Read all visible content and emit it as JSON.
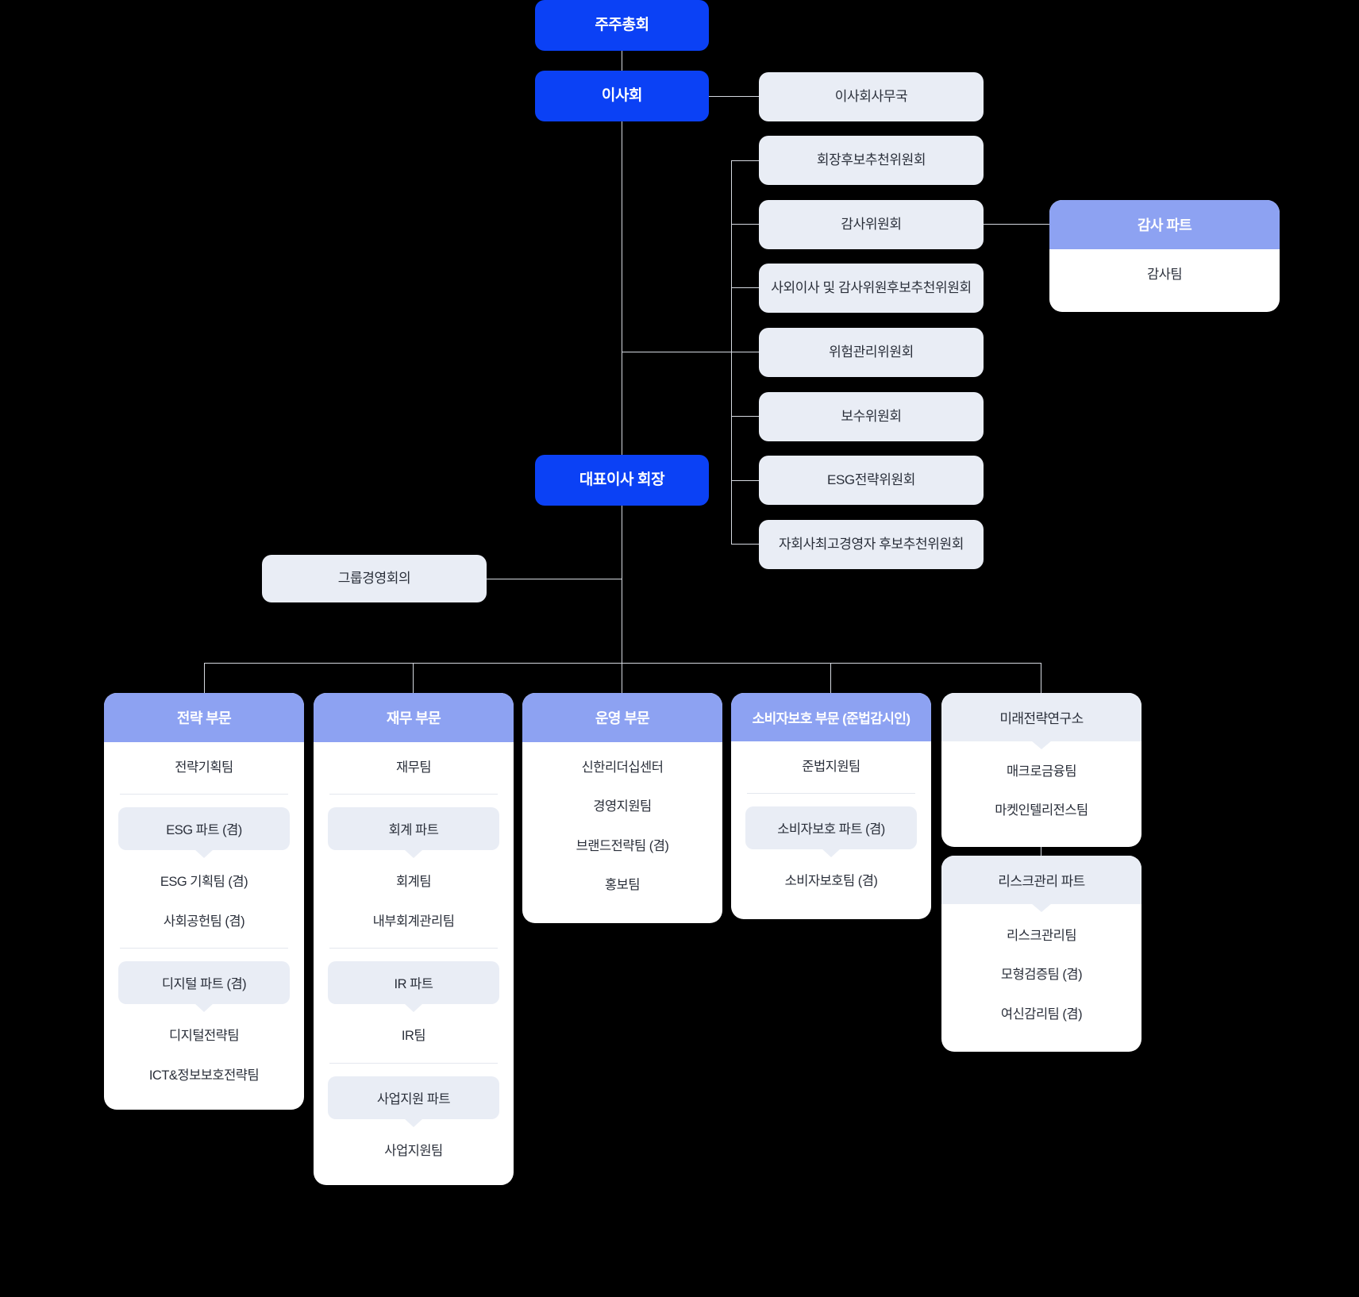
{
  "colors": {
    "primary": "#0b41f5",
    "division_header": "#8da2f2",
    "neutral_box": "#e9edf5",
    "line": "#d5d9e0",
    "background": "#000000",
    "card": "#ffffff",
    "text_dark": "#2a2f3a"
  },
  "top": {
    "shareholders_meeting": "주주총회",
    "board_of_directors": "이사회",
    "board_secretariat": "이사회사무국",
    "ceo_chairman": "대표이사 회장",
    "group_management_meeting": "그룹경영회의"
  },
  "committees": [
    {
      "label": "회장후보추천위원회"
    },
    {
      "label": "감사위원회"
    },
    {
      "label": "사외이사 및 감사위원후보추천위원회"
    },
    {
      "label": "위험관리위원회"
    },
    {
      "label": "보수위원회"
    },
    {
      "label": "ESG전략위원회"
    },
    {
      "label": "자회사최고경영자 후보추천위원회"
    }
  ],
  "audit": {
    "header": "감사 파트",
    "teams": [
      "감사팀"
    ]
  },
  "divisions": [
    {
      "header": "전략 부문",
      "header_style": "accent",
      "groups": [
        {
          "part": null,
          "teams": [
            "전략기획팀"
          ]
        },
        {
          "part": "ESG 파트 (겸)",
          "teams": [
            "ESG 기획팀 (겸)",
            "사회공헌팀 (겸)"
          ]
        },
        {
          "part": "디지털 파트 (겸)",
          "teams": [
            "디지털전략팀",
            "ICT&정보보호전략팀"
          ]
        }
      ]
    },
    {
      "header": "재무 부문",
      "header_style": "accent",
      "groups": [
        {
          "part": null,
          "teams": [
            "재무팀"
          ]
        },
        {
          "part": "회계 파트",
          "teams": [
            "회계팀",
            "내부회계관리팀"
          ]
        },
        {
          "part": "IR 파트",
          "teams": [
            "IR팀"
          ]
        },
        {
          "part": "사업지원 파트",
          "teams": [
            "사업지원팀"
          ]
        }
      ]
    },
    {
      "header": "운영 부문",
      "header_style": "accent",
      "groups": [
        {
          "part": null,
          "teams": [
            "신한리더십센터",
            "경영지원팀",
            "브랜드전략팀 (겸)",
            "홍보팀"
          ]
        }
      ]
    },
    {
      "header": "소비자보호 부문 (준법감시인)",
      "header_style": "accent",
      "groups": [
        {
          "part": null,
          "teams": [
            "준법지원팀"
          ]
        },
        {
          "part": "소비자보호 파트 (겸)",
          "teams": [
            "소비자보호팀 (겸)"
          ]
        }
      ]
    }
  ],
  "research": {
    "header": "미래전략연구소",
    "header_style": "neutral",
    "teams": [
      "매크로금융팀",
      "마켓인텔리전스팀"
    ],
    "risk": {
      "part": "리스크관리 파트",
      "teams": [
        "리스크관리팀",
        "모형검증팀 (겸)",
        "여신감리팀 (겸)"
      ]
    }
  }
}
